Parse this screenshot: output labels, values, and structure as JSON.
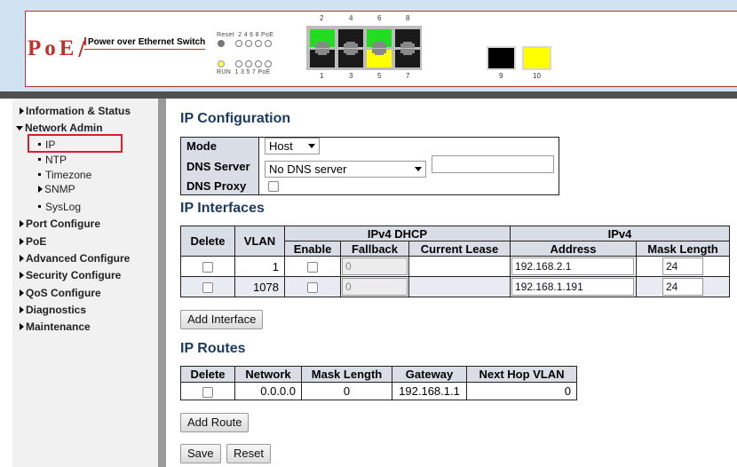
{
  "banner": {
    "logo": "PoE",
    "logo_text": "Power over Ethernet Switch",
    "reset_label": "Reset",
    "run_label": "RUN",
    "top_led_nums": "2 4 6 8 PoE",
    "bottom_led_nums": "1 3 5 7 PoE",
    "top_ports": [
      "2",
      "4",
      "6",
      "8"
    ],
    "bottom_ports": [
      "1",
      "3",
      "5",
      "7"
    ],
    "sfp_ports": [
      "9",
      "10"
    ],
    "colors": {
      "port_green": "#22dd22",
      "port_yellow": "#ffff00",
      "port_black": "#1a1a1a",
      "border_red": "#c0302c"
    }
  },
  "sidebar": {
    "items": [
      {
        "label": "Information & Status"
      },
      {
        "label": "Network Admin"
      },
      {
        "label": "IP"
      },
      {
        "label": "NTP"
      },
      {
        "label": "Timezone"
      },
      {
        "label": "SNMP"
      },
      {
        "label": "SysLog"
      },
      {
        "label": "Port Configure"
      },
      {
        "label": "PoE"
      },
      {
        "label": "Advanced Configure"
      },
      {
        "label": "Security Configure"
      },
      {
        "label": "QoS Configure"
      },
      {
        "label": "Diagnostics"
      },
      {
        "label": "Maintenance"
      }
    ]
  },
  "ip_config": {
    "title": "IP Configuration",
    "mode_label": "Mode",
    "mode_value": "Host",
    "dns_server_label": "DNS Server",
    "dns_server_value": "No DNS server",
    "dns_server_extra": "",
    "dns_proxy_label": "DNS Proxy"
  },
  "ip_interfaces": {
    "title": "IP Interfaces",
    "headers": {
      "delete": "Delete",
      "vlan": "VLAN",
      "dhcp_group": "IPv4 DHCP",
      "ipv4_group": "IPv4",
      "enable": "Enable",
      "fallback": "Fallback",
      "current_lease": "Current Lease",
      "address": "Address",
      "mask_length": "Mask Length"
    },
    "rows": [
      {
        "vlan": "1",
        "fallback": "0",
        "current_lease": "",
        "address": "192.168.2.1",
        "mask": "24"
      },
      {
        "vlan": "1078",
        "fallback": "0",
        "current_lease": "",
        "address": "192.168.1.191",
        "mask": "24"
      }
    ],
    "add_button": "Add Interface"
  },
  "ip_routes": {
    "title": "IP Routes",
    "headers": [
      "Delete",
      "Network",
      "Mask Length",
      "Gateway",
      "Next Hop VLAN"
    ],
    "rows": [
      {
        "network": "0.0.0.0",
        "mask": "0",
        "gateway": "192.168.1.1",
        "next_hop_vlan": "0"
      }
    ],
    "add_button": "Add Route"
  },
  "actions": {
    "save": "Save",
    "reset": "Reset"
  }
}
